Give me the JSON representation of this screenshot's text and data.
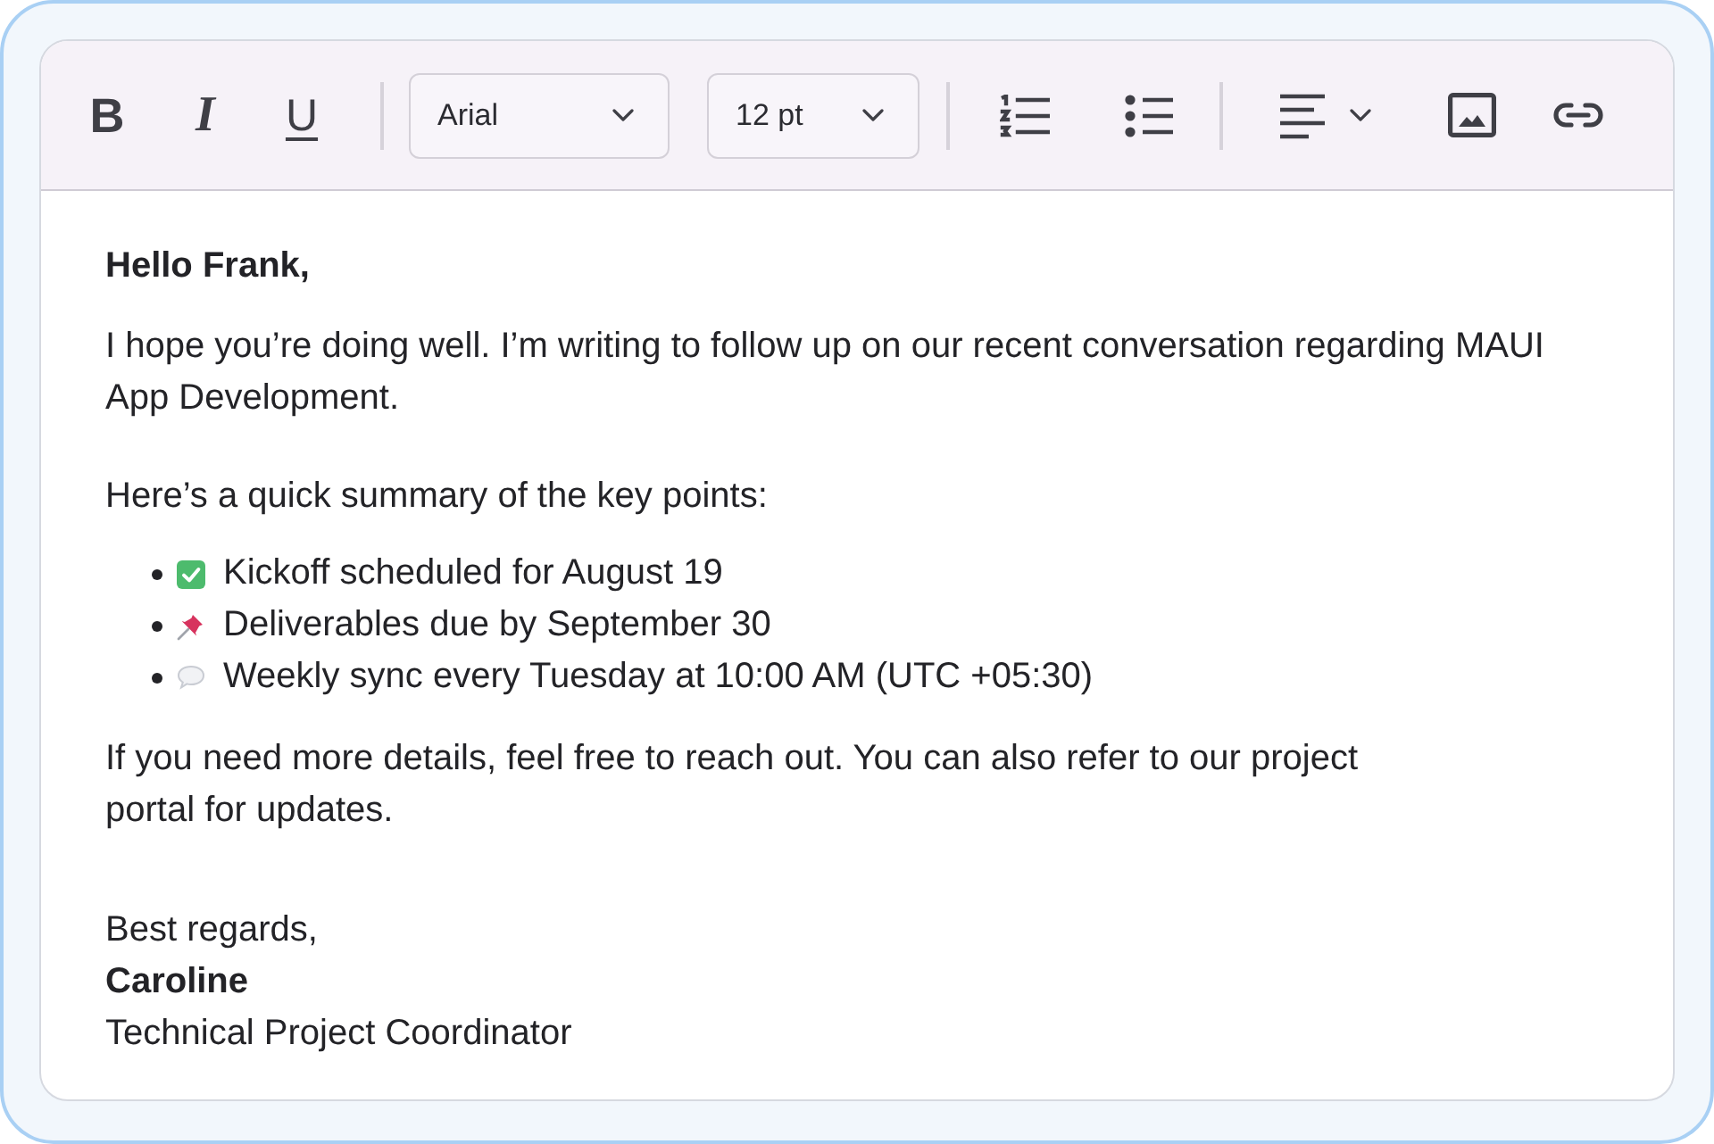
{
  "toolbar": {
    "format_buttons": [
      {
        "kind": "bold",
        "label": "B"
      },
      {
        "kind": "italic",
        "label": "I"
      },
      {
        "kind": "underline",
        "label": "U"
      }
    ],
    "font_select": {
      "value": "Arial"
    },
    "size_select": {
      "value": "12 pt"
    }
  },
  "message": {
    "greeting": "Hello Frank,",
    "intro": "I hope you’re doing well. I’m writing to follow up on our recent conversation regarding MAUI App Development.",
    "summary_intro": "Here’s a quick summary of the key points:",
    "points": [
      {
        "kind": "check",
        "text": "Kickoff scheduled for August 19"
      },
      {
        "kind": "pin",
        "text": "Deliverables due by September 30"
      },
      {
        "kind": "speech",
        "text": "Weekly sync every Tuesday at 10:00 AM (UTC +05:30)"
      }
    ],
    "closing": "If you need more details, feel free to reach out. You can also refer to our project\nportal for updates.",
    "sign_off": "Best regards,",
    "sender_name": "Caroline",
    "sender_title": "Technical Project Coordinator"
  }
}
